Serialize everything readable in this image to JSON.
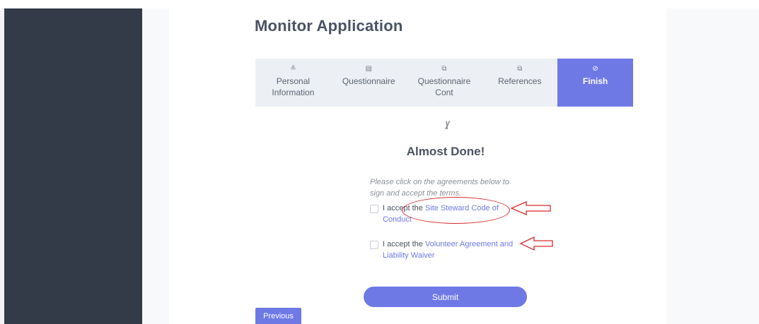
{
  "app": {
    "title": "Monitor Application"
  },
  "steps": [
    {
      "label": "Personal Information",
      "icon": "user-icon",
      "glyph": "≗",
      "active": false
    },
    {
      "label": "Questionnaire",
      "icon": "document-icon",
      "glyph": "▤",
      "active": false
    },
    {
      "label": "Questionnaire Cont",
      "icon": "document-edit-icon",
      "glyph": "⧉",
      "active": false
    },
    {
      "label": "References",
      "icon": "copy-icon",
      "glyph": "⧉",
      "active": false
    },
    {
      "label": "Finish",
      "icon": "check-circle-icon",
      "glyph": "⊘",
      "active": true
    }
  ],
  "finish": {
    "icon": "double-check-icon",
    "icon_glyph": "\\\\//",
    "title": "Almost Done!",
    "instructions": "Please click on the agreements below to sign and accept the terms."
  },
  "agreements": [
    {
      "prefix": "I accept the ",
      "link": "Site Steward Code of Conduct",
      "checked": false
    },
    {
      "prefix": "I accept the ",
      "link": "Volunteer Agreement and Liability Waiver",
      "checked": false
    }
  ],
  "buttons": {
    "submit": "Submit",
    "previous": "Previous"
  },
  "colors": {
    "accent": "#6e79e6",
    "sidebar": "#333a48",
    "annotation": "#d72a2a"
  }
}
